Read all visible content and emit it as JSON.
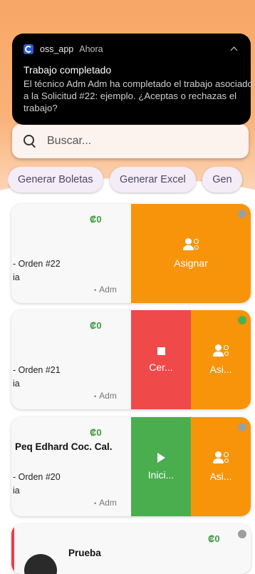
{
  "notification": {
    "app_name": "oss_app",
    "time": "Ahora",
    "title": "Trabajo completado",
    "body": "El técnico Adm Adm ha completado el trabajo asociado a la Solicitud #22: ejemplo. ¿Aceptas o rechazas el trabajo?"
  },
  "search": {
    "placeholder": "Buscar..."
  },
  "chips": [
    "Generar Boletas",
    "Generar Excel",
    "Gen"
  ],
  "cards": [
    {
      "price": "₡0",
      "client": "",
      "order": "- Orden #22",
      "sub": "ia",
      "assignee": "Adm",
      "status_color": "#9e9e9e",
      "actions": [
        {
          "label": "Asignar",
          "icon": "assign-user-icon",
          "color": "#f7940a"
        }
      ]
    },
    {
      "price": "₡0",
      "client": "",
      "order": "- Orden #21",
      "sub": "ia",
      "assignee": "Adm",
      "status_color": "#4caf50",
      "actions": [
        {
          "label": "Cer...",
          "icon": "stop-icon",
          "color": "#ef4949"
        },
        {
          "label": "Asi...",
          "icon": "assign-user-icon",
          "color": "#f7940a"
        }
      ]
    },
    {
      "price": "₡0",
      "client": "Peq Edhard Coc. Cal.",
      "order": "- Orden #20",
      "sub": "ia",
      "assignee": "Adm",
      "status_color": "#9e9e9e",
      "actions": [
        {
          "label": "Inici...",
          "icon": "play-icon",
          "color": "#4aae4f"
        },
        {
          "label": "Asi...",
          "icon": "assign-user-icon",
          "color": "#f7940a"
        }
      ]
    }
  ],
  "partial_card": {
    "price": "₡0",
    "title": "Prueba",
    "status_color": "#9e9e9e",
    "accent_color": "#ef3b4d"
  }
}
